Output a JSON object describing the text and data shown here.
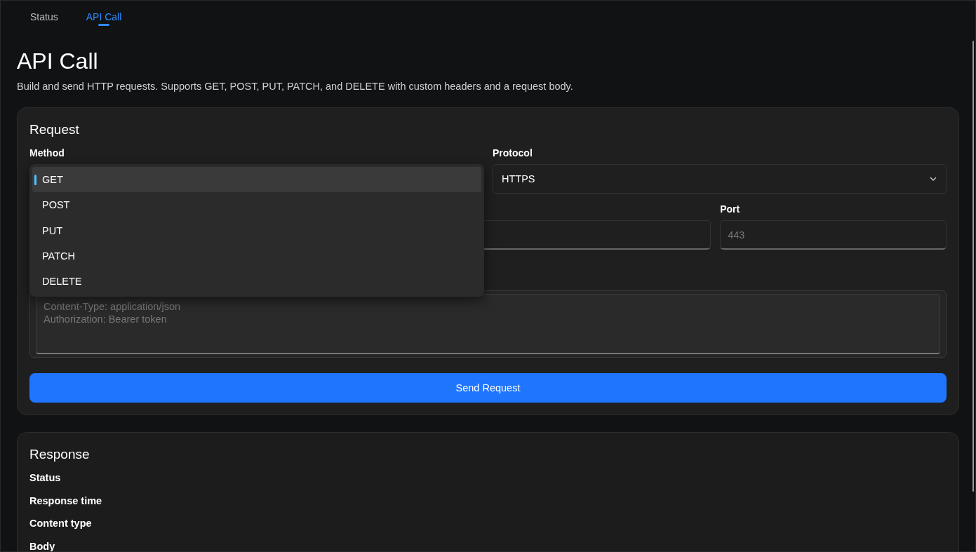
{
  "tabs": [
    {
      "label": "Status",
      "selected": false
    },
    {
      "label": "API Call",
      "selected": true
    }
  ],
  "page": {
    "title": "API Call",
    "description": "Build and send HTTP requests. Supports GET, POST, PUT, PATCH, and DELETE with custom headers and a request body."
  },
  "request": {
    "title": "Request",
    "method": {
      "label": "Method",
      "options": [
        {
          "label": "GET",
          "selected": true
        },
        {
          "label": "POST",
          "selected": false
        },
        {
          "label": "PUT",
          "selected": false
        },
        {
          "label": "PATCH",
          "selected": false
        },
        {
          "label": "DELETE",
          "selected": false
        }
      ]
    },
    "protocol": {
      "label": "Protocol",
      "value": "HTTPS"
    },
    "port": {
      "label": "Port",
      "placeholder": "443"
    },
    "headers": {
      "placeholder": "Content-Type: application/json\nAuthorization: Bearer token"
    },
    "send_button": "Send Request"
  },
  "response": {
    "title": "Response",
    "fields": [
      "Status",
      "Response time",
      "Content type",
      "Body"
    ]
  }
}
